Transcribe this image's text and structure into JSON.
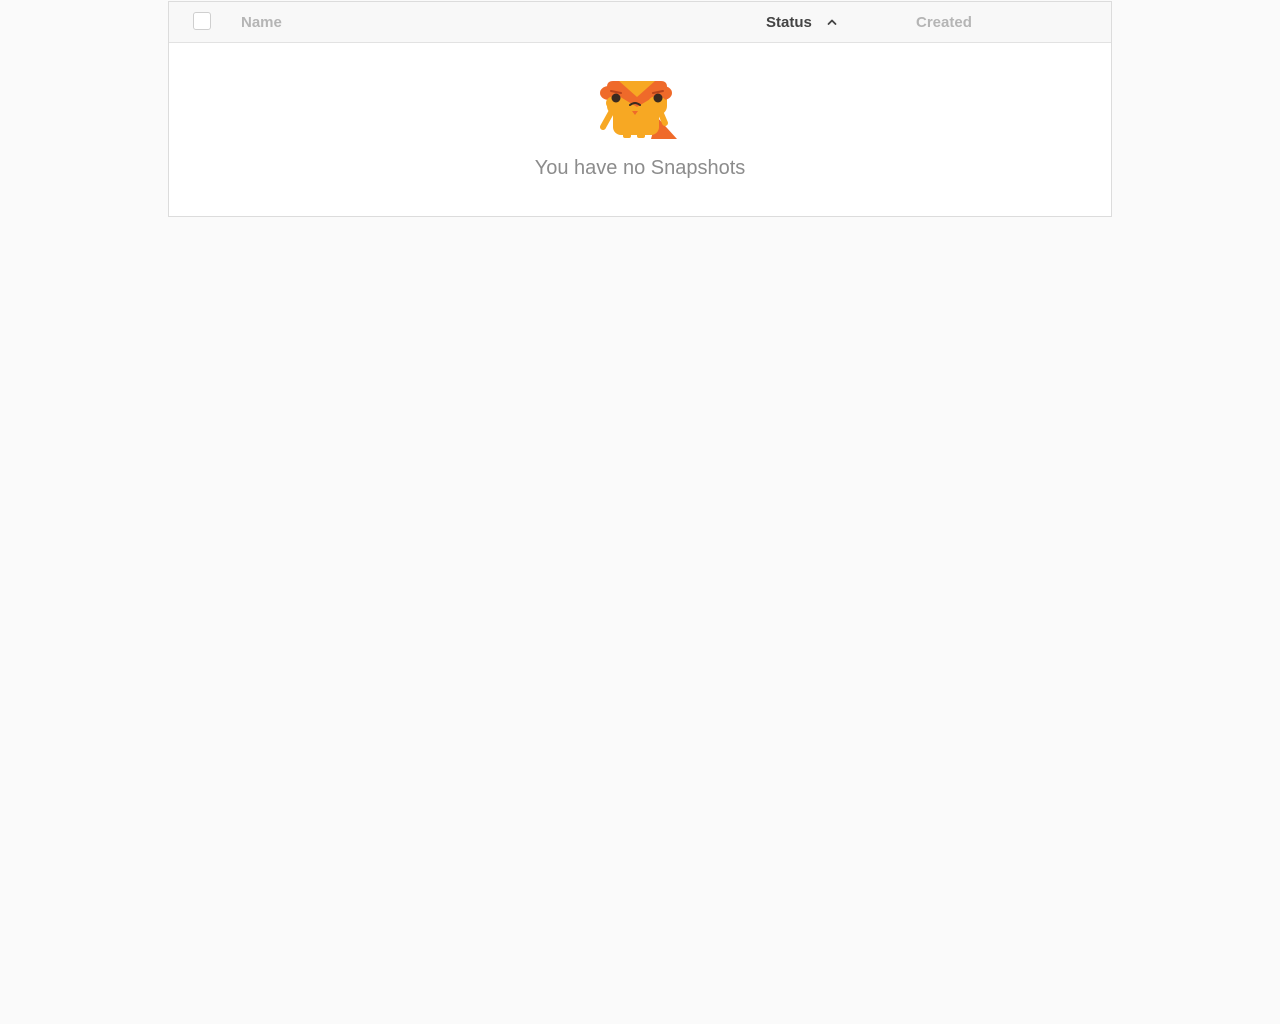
{
  "table": {
    "columns": {
      "name": "Name",
      "status": "Status",
      "created": "Created"
    },
    "sort": {
      "column": "Status",
      "direction": "ascending",
      "icon": "chevron-up-icon"
    },
    "select_all_checked": false
  },
  "empty_state": {
    "icon": "sad-fox-mascot-icon",
    "message": "You have no Snapshots"
  },
  "colors": {
    "page_background": "#fafafa",
    "header_background": "#f8f8f8",
    "active_header_text": "#444444",
    "inactive_header_text": "#b5b5b5",
    "empty_text": "#8c8c8c",
    "mascot_orange": "#f7a823",
    "mascot_dark_orange": "#ef6a2a"
  }
}
